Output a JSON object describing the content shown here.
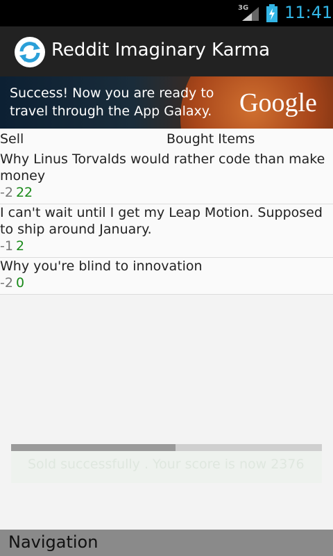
{
  "status_bar": {
    "network_label": "3G",
    "time": "11:41",
    "icons": [
      "signal-icon",
      "battery-charging-icon"
    ]
  },
  "action_bar": {
    "title": "Reddit Imaginary Karma",
    "logo_icon": "refresh-icon"
  },
  "ad_banner": {
    "line1": "Success! Now you are ready to",
    "line2": "travel through the App Galaxy.",
    "brand": "Google"
  },
  "tabs": {
    "sell_label": "Sell",
    "bought_label": "Bought Items"
  },
  "items": [
    {
      "title": "Why Linus Torvalds would rather code than make money",
      "cost": "-2",
      "value": "22"
    },
    {
      "title": "I can't wait until I get my Leap Motion. Supposed to ship around January.",
      "cost": "-1",
      "value": "2"
    },
    {
      "title": "Why you're blind to innovation",
      "cost": "-2",
      "value": "0"
    }
  ],
  "toast": {
    "text": "Sold successfully . Your score is now 2376",
    "progress": 0.53
  },
  "navigation": {
    "label": "Navigation"
  },
  "colors": {
    "accent": "#33b5e5",
    "positive": "#1a8a1a",
    "action_bar": "#222222",
    "nav_bar": "#8a8a8a"
  }
}
